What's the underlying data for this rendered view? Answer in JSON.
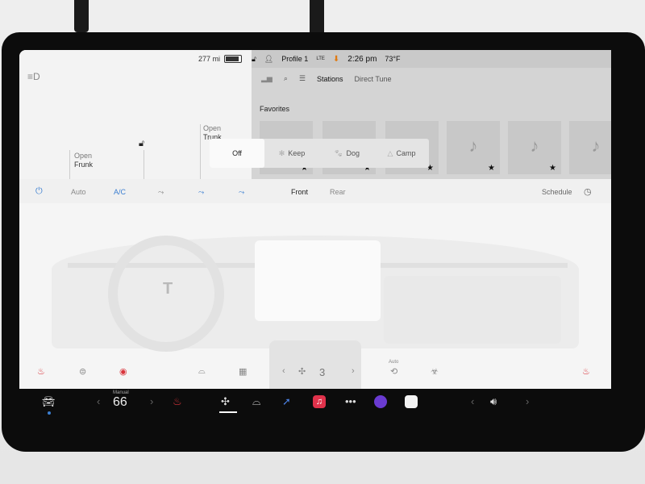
{
  "status": {
    "range": "277 mi",
    "profile": "Profile 1",
    "network": "LTE",
    "time": "2:26 pm",
    "outside_temp": "73°F"
  },
  "car": {
    "frunk_action": "Open",
    "frunk_name": "Frunk",
    "trunk_action": "Open",
    "trunk_name": "Trunk"
  },
  "media": {
    "tabs": [
      "Stations",
      "Direct Tune"
    ],
    "favorites_label": "Favorites"
  },
  "modes": [
    "Off",
    "Keep",
    "Dog",
    "Camp"
  ],
  "climate": {
    "auto": "Auto",
    "ac": "A/C",
    "front": "Front",
    "rear": "Rear",
    "schedule": "Schedule",
    "fan_speed": "3",
    "auto_small": "Auto"
  },
  "dock": {
    "temp_mode": "Manual",
    "temp_value": "66"
  },
  "colors": {
    "accent_blue": "#3c7fd1",
    "dock_bg": "#0c0c0c",
    "seat_heat_red": "#d9343b"
  }
}
